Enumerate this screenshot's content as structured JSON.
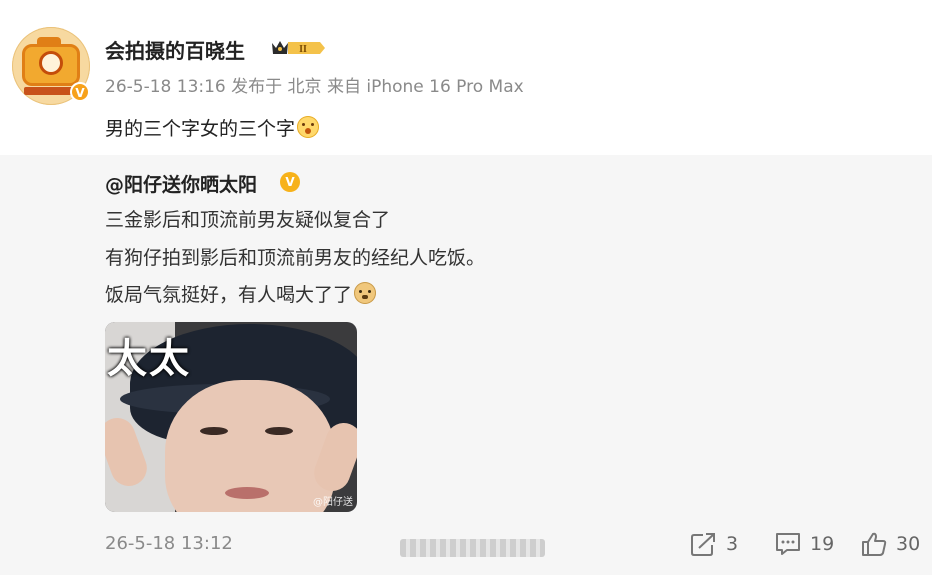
{
  "post": {
    "author": "会拍摄的百晓生",
    "verified_mark": "V",
    "meta": "26-5-18 13:16 发布于 北京 来自 iPhone 16 Pro Max",
    "text": "男的三个字女的三个字",
    "text_emoji": "surprised-face-emoji",
    "badge_icon": "crown-level-badge-icon"
  },
  "repost": {
    "author": "@阳仔送你晒太阳",
    "verified_mark": "V",
    "lines": [
      "三金影后和顶流前男友疑似复合了",
      "有狗仔拍到影后和顶流前男友的经纪人吃饭。",
      "饭局气氛挺好，有人喝大了了"
    ],
    "line3_emoji": "doge-emoji",
    "image_overlay_text": "太太",
    "image_watermark": "@阳仔送",
    "time": "26-5-18 13:12",
    "actions": {
      "repost_count": "3",
      "comment_count": "19",
      "like_count": "30"
    }
  },
  "colors": {
    "accent": "#f7a11a",
    "repost_bg": "#f6f6f6",
    "meta_text": "#8a8a8a"
  }
}
